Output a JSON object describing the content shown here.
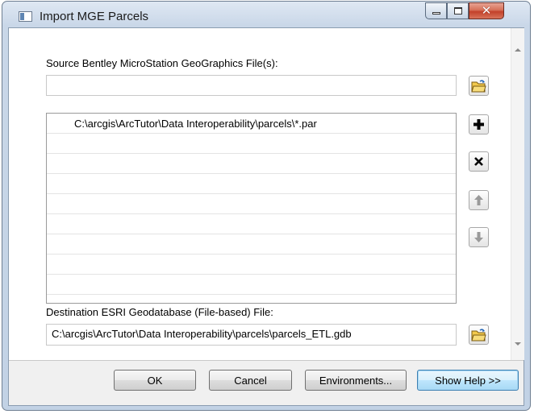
{
  "window": {
    "title": "Import MGE Parcels",
    "icon": "app-icon",
    "close_glyph": "✕"
  },
  "form": {
    "source_label": "Source Bentley MicroStation GeoGraphics File(s):",
    "source_value": "",
    "source_browse_icon": "open-folder-icon",
    "source_list": [
      "C:\\arcgis\\ArcTutor\\Data Interoperability\\parcels\\*.par",
      "",
      "",
      "",
      "",
      "",
      "",
      "",
      "",
      ""
    ],
    "list_buttons": {
      "add_icon": "plus-icon",
      "remove_icon": "x-icon",
      "up_icon": "arrow-up-icon",
      "down_icon": "arrow-down-icon"
    },
    "destination_label": "Destination ESRI Geodatabase (File-based) File:",
    "destination_value": "C:\\arcgis\\ArcTutor\\Data Interoperability\\parcels\\parcels_ETL.gdb",
    "destination_browse_icon": "open-folder-icon"
  },
  "buttons": {
    "ok": "OK",
    "cancel": "Cancel",
    "environments": "Environments...",
    "show_help": "Show Help >>"
  },
  "colors": {
    "frame": "#c9d7e8",
    "close_button": "#c2412a",
    "focus_button": "#a7d9f5"
  }
}
